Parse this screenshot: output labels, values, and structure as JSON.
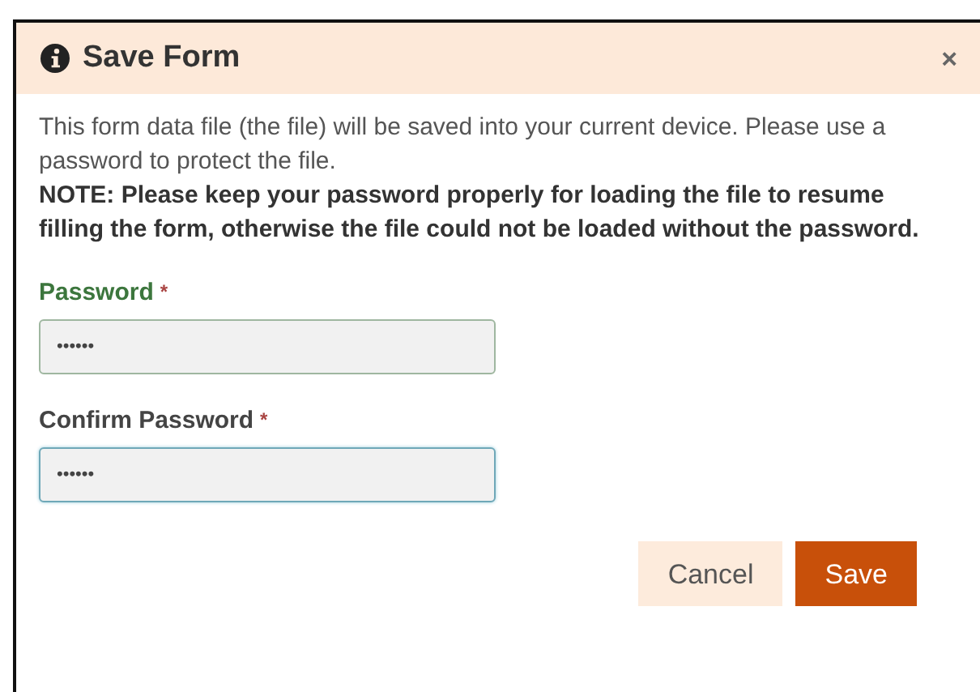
{
  "dialog": {
    "title": "Save Form",
    "close": "×"
  },
  "message": {
    "text": "This form data file (the file) will be saved into your current device. Please use a password to protect the file.",
    "note": "NOTE: Please keep your password properly for loading the file to resume filling the form, otherwise the file could not be loaded without the password."
  },
  "fields": [
    {
      "label": "Password",
      "required_mark": "*",
      "value": "••••••",
      "valid": true,
      "focused": false
    },
    {
      "label": "Confirm Password",
      "required_mark": "*",
      "value": "••••••",
      "valid": false,
      "focused": true
    }
  ],
  "buttons": [
    {
      "label": "Cancel",
      "kind": "secondary"
    },
    {
      "label": "Save",
      "kind": "primary"
    }
  ]
}
